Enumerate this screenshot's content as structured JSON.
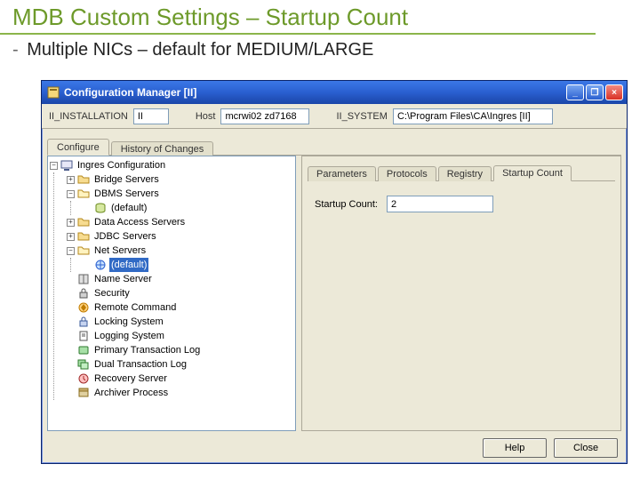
{
  "slide": {
    "title": "MDB Custom Settings – Startup Count",
    "subtitle": "Multiple NICs – default for MEDIUM/LARGE"
  },
  "window": {
    "title": "Configuration Manager [II]",
    "min": "_",
    "restore": "❐",
    "close": "×"
  },
  "toolbar": {
    "label_install": "II_INSTALLATION",
    "value_install": "II",
    "label_host": "Host",
    "value_host": "mcrwi02 zd7168",
    "label_system": "II_SYSTEM",
    "value_system": "C:\\Program Files\\CA\\Ingres [II]"
  },
  "tabs": {
    "configure": "Configure",
    "history": "History of Changes"
  },
  "tree": {
    "root": "Ingres Configuration",
    "bridge": "Bridge Servers",
    "dbms": "DBMS Servers",
    "dbms_default": "(default)",
    "data_access": "Data Access Servers",
    "jdbc": "JDBC Servers",
    "net": "Net Servers",
    "net_default": "(default)",
    "name_server": "Name Server",
    "security": "Security",
    "remote_command": "Remote Command",
    "locking": "Locking System",
    "logging": "Logging System",
    "primary_log": "Primary Transaction Log",
    "dual_log": "Dual Transaction Log",
    "recovery": "Recovery Server",
    "archiver": "Archiver Process"
  },
  "right": {
    "tabs": {
      "parameters": "Parameters",
      "protocols": "Protocols",
      "registry": "Registry",
      "startup": "Startup Count"
    },
    "label_startup": "Startup Count:",
    "value_startup": "2"
  },
  "buttons": {
    "help": "Help",
    "close": "Close"
  },
  "icons": {
    "minus": "−",
    "plus": "+"
  }
}
